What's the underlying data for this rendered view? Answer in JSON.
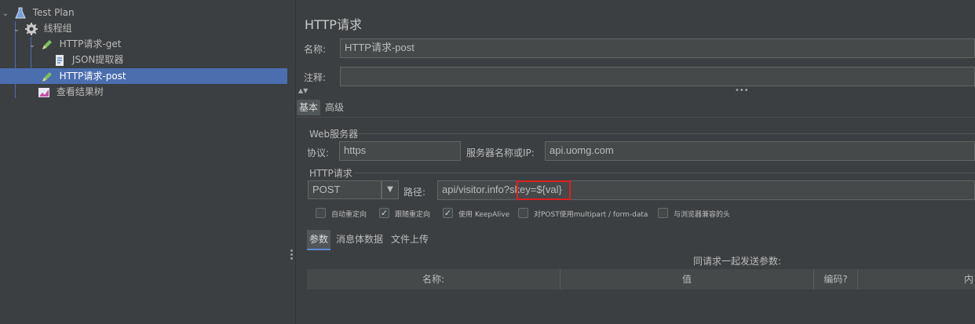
{
  "tree": {
    "items": [
      {
        "label": "Test Plan",
        "icon": "test-plan-flask-icon"
      },
      {
        "label": "线程组",
        "icon": "thread-group-gear-icon"
      },
      {
        "label": "HTTP请求-get",
        "icon": "http-sampler-pen-icon"
      },
      {
        "label": "JSON提取器",
        "icon": "json-extractor-doc-icon"
      },
      {
        "label": "HTTP请求-post",
        "icon": "http-sampler-pen-icon"
      },
      {
        "label": "查看结果树",
        "icon": "results-tree-chart-icon"
      }
    ]
  },
  "header": {
    "title": "HTTP请求"
  },
  "form": {
    "name_label": "名称:",
    "name_value": "HTTP请求-post",
    "comment_label": "注释:",
    "comment_value": ""
  },
  "tabs": {
    "basic": "基本",
    "advanced": "高级"
  },
  "web_server": {
    "title": "Web服务器",
    "protocol_label": "协议:",
    "protocol_value": "https",
    "server_label": "服务器名称或IP:",
    "server_value": "api.uomg.com"
  },
  "http_request": {
    "title": "HTTP请求",
    "method": "POST",
    "path_label": "路径:",
    "path_value": "api/visitor.info?skey=${val}"
  },
  "options": [
    {
      "label": "自动重定向",
      "checked": false
    },
    {
      "label": "跟随重定向",
      "checked": true
    },
    {
      "label": "使用 KeepAlive",
      "checked": true
    },
    {
      "label": "对POST使用multipart / form-data",
      "checked": false
    },
    {
      "label": "与浏览器兼容的头",
      "checked": false
    }
  ],
  "sub_tabs": {
    "params": "参数",
    "body": "消息体数据",
    "upload": "文件上传"
  },
  "params_table": {
    "caption": "同请求一起发送参数:",
    "headers": [
      "名称:",
      "值",
      "编码?",
      "内"
    ]
  },
  "colors": {
    "selection": "#4b6eaf",
    "highlight_box": "#e02020",
    "background": "#3c3f41"
  }
}
